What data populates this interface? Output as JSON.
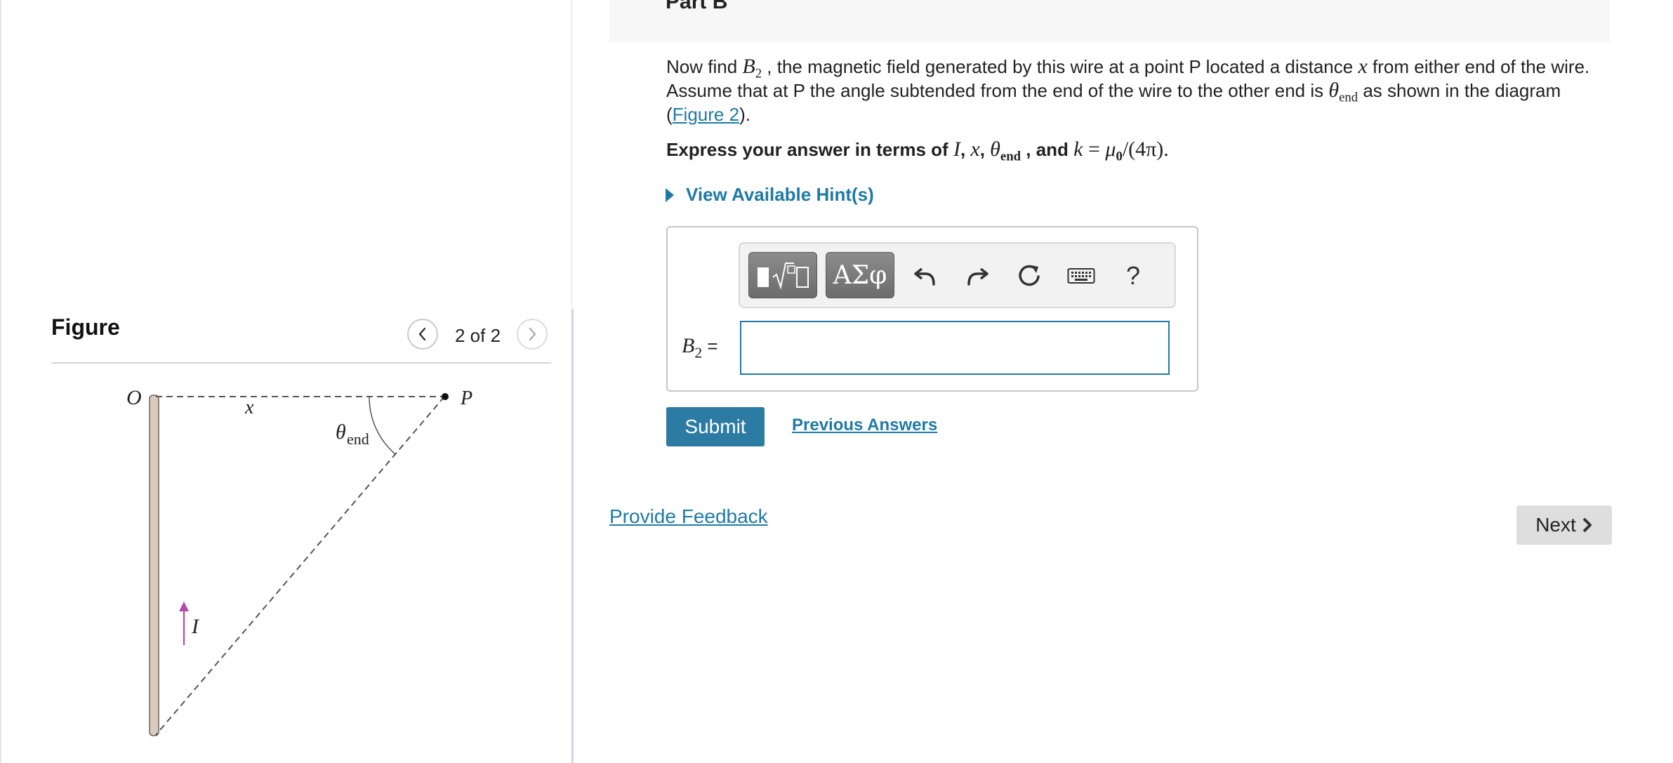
{
  "part": {
    "title": "Part B"
  },
  "question": {
    "p1": "Now find ",
    "b2_sym": "B",
    "b2_sub": "2",
    "p2": " , the magnetic field generated by this wire at a point P located a distance ",
    "x_sym": "x",
    "p3": " from either end of the wire. Assume that at P the angle subtended from the end of the wire to the other end is ",
    "theta_sym": "θ",
    "theta_sub": "end",
    "p4": "  as shown in the diagram (",
    "figure_link": "Figure 2",
    "p5": ")."
  },
  "instruction": {
    "prefix": "Express your answer in terms of ",
    "I": "I",
    "comma": ", ",
    "x": "x",
    "theta": "θ",
    "theta_sub": "end",
    "and": " , and ",
    "k": "k",
    "eq": " = ",
    "mu": "μ",
    "mu_sub": "0",
    "tail": "/(4π).",
    "pi": "π"
  },
  "hint": {
    "label": "View Available Hint(s)"
  },
  "toolbar": {
    "templates_icon": "templates-sqrt-icon",
    "symbols_label": "ΑΣφ",
    "undo_icon": "undo-icon",
    "redo_icon": "redo-icon",
    "reset_icon": "reset-icon",
    "keyboard_icon": "keyboard-icon",
    "help_label": "?"
  },
  "answer": {
    "label_sym": "B",
    "label_sub": "2",
    "label_eq": " =",
    "value": "",
    "placeholder": ""
  },
  "buttons": {
    "submit": "Submit",
    "previous_answers": "Previous Answers",
    "provide_feedback": "Provide Feedback",
    "next": "Next"
  },
  "figure": {
    "title": "Figure",
    "counter": "2 of 2",
    "labels": {
      "O": "O",
      "x": "x",
      "P": "P",
      "theta": "θ",
      "theta_sub": "end",
      "I": "I"
    }
  },
  "colors": {
    "accent": "#1f7aa5",
    "submit_bg": "#2c7ba3",
    "current_arrow": "#b24aa8",
    "wire": "#d9cbbf"
  }
}
